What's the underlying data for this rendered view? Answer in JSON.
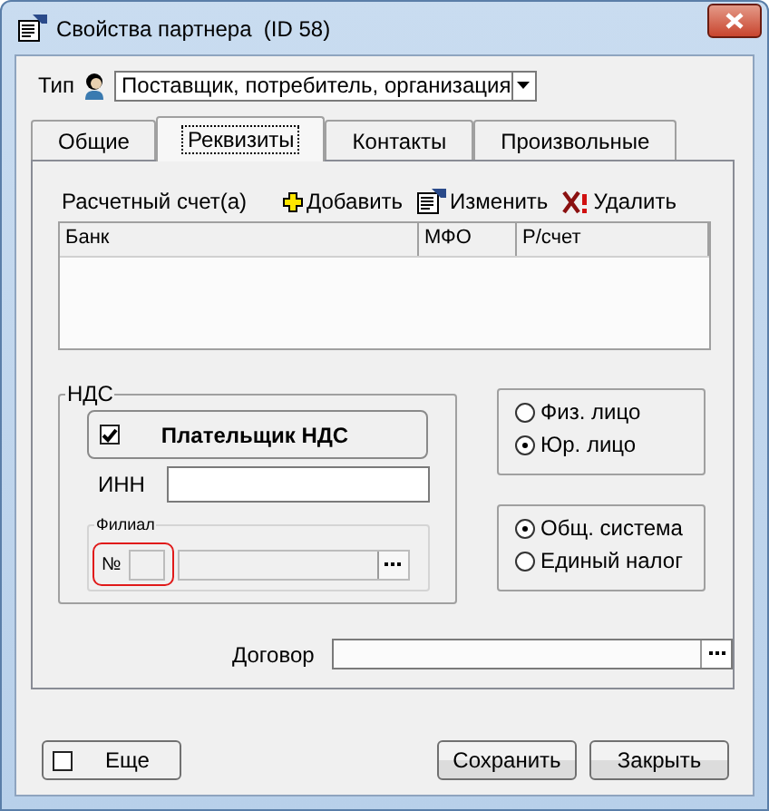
{
  "window": {
    "title": "Свойства партнера  (ID 58)"
  },
  "type": {
    "label": "Тип",
    "value": "Поставщик, потребитель, организация"
  },
  "tabs": [
    {
      "label": "Общие",
      "selected": false
    },
    {
      "label": "Реквизиты",
      "selected": true
    },
    {
      "label": "Контакты",
      "selected": false
    },
    {
      "label": "Произвольные",
      "selected": false
    }
  ],
  "accounts": {
    "label": "Расчетный счет(а)",
    "actions": [
      {
        "kind": "add",
        "label": "Добавить"
      },
      {
        "kind": "edit",
        "label": "Изменить"
      },
      {
        "kind": "delete",
        "label": "Удалить"
      }
    ],
    "columns": [
      "Банк",
      "МФО",
      "Р/счет"
    ]
  },
  "vat": {
    "legend": "НДС",
    "payer": {
      "label": "Плательщик НДС",
      "checked": true
    },
    "inn": {
      "label": "ИНН"
    },
    "branch": {
      "legend": "Филиал",
      "number_label": "№",
      "highlighted": true
    }
  },
  "person_type": [
    {
      "label": "Физ. лицо",
      "selected": false
    },
    {
      "label": "Юр. лицо",
      "selected": true
    }
  ],
  "tax_system": [
    {
      "label": "Общ. система",
      "selected": true
    },
    {
      "label": "Единый налог",
      "selected": false
    }
  ],
  "contract": {
    "label": "Договор"
  },
  "more": {
    "label": "Еще",
    "checked": false
  },
  "buttons": [
    "Сохранить",
    "Закрыть"
  ]
}
